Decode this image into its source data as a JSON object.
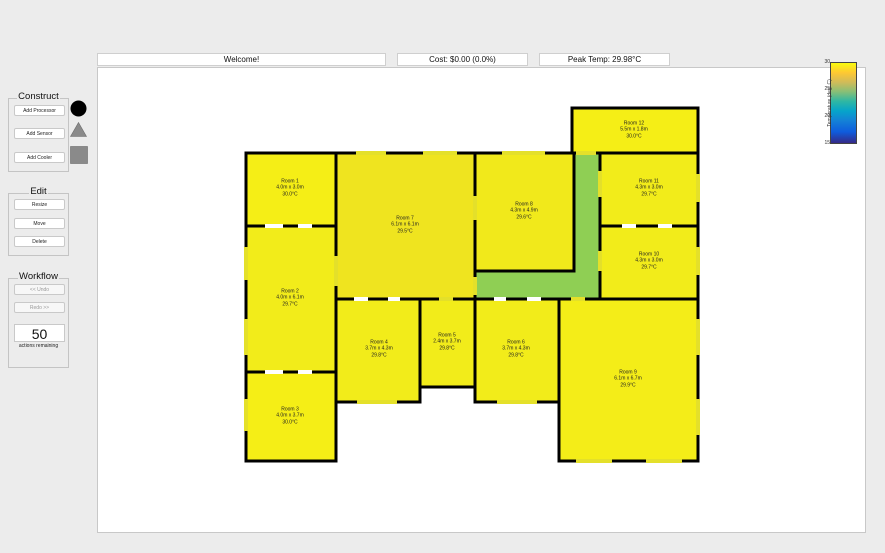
{
  "header": {
    "welcome": "Welcome!",
    "cost": "Cost: $0.00 (0.0%)",
    "peak_temp": "Peak Temp: 29.98°C"
  },
  "construct": {
    "title": "Construct",
    "add_processor": "Add Processor",
    "add_sensor": "Add Sensor",
    "add_cooler": "Add Cooler",
    "icons": [
      "circle-processor-icon",
      "triangle-sensor-icon",
      "square-cooler-icon"
    ]
  },
  "edit": {
    "title": "Edit",
    "resize": "Resize",
    "move": "Move",
    "delete": "Delete"
  },
  "workflow": {
    "title": "Workflow",
    "undo": "<< Undo",
    "redo": "Redo >>",
    "actions_count": "50",
    "actions_label": "actions remaining"
  },
  "colorbar": {
    "label": "Temperature (deg. C)",
    "max": "30",
    "mid": "25",
    "low": "20",
    "min": "15",
    "colors": [
      "#352a87",
      "#0f5cdd",
      "#06a4ca",
      "#87bf77",
      "#fec832",
      "#f9fb0e"
    ]
  },
  "colors": {
    "room_fill": "#f5ee16",
    "hot_fill": "#f2f01b",
    "corridor": "#8fcf54",
    "wall": "#000000",
    "opening": "#e4e02a"
  },
  "rooms": [
    {
      "name": "Room 1",
      "size": "4.0m x 3.0m",
      "temp": "30.0°C"
    },
    {
      "name": "Room 2",
      "size": "4.0m x 6.1m",
      "temp": "29.7°C"
    },
    {
      "name": "Room 3",
      "size": "4.0m x 3.7m",
      "temp": "30.0°C"
    },
    {
      "name": "Room 4",
      "size": "3.7m x 4.3m",
      "temp": "29.8°C"
    },
    {
      "name": "Room 5",
      "size": "2.4m x 3.7m",
      "temp": "29.8°C"
    },
    {
      "name": "Room 6",
      "size": "3.7m x 4.3m",
      "temp": "29.8°C"
    },
    {
      "name": "Room 7",
      "size": "6.1m x 6.1m",
      "temp": "29.5°C"
    },
    {
      "name": "Room 8",
      "size": "4.3m x 4.9m",
      "temp": "29.6°C"
    },
    {
      "name": "Room 9",
      "size": "6.1m x 6.7m",
      "temp": "29.9°C"
    },
    {
      "name": "Room 10",
      "size": "4.3m x 3.0m",
      "temp": "29.7°C"
    },
    {
      "name": "Room 11",
      "size": "4.3m x 3.0m",
      "temp": "29.7°C"
    },
    {
      "name": "Room 12",
      "size": "5.5m x 1.8m",
      "temp": "30.0°C"
    }
  ]
}
